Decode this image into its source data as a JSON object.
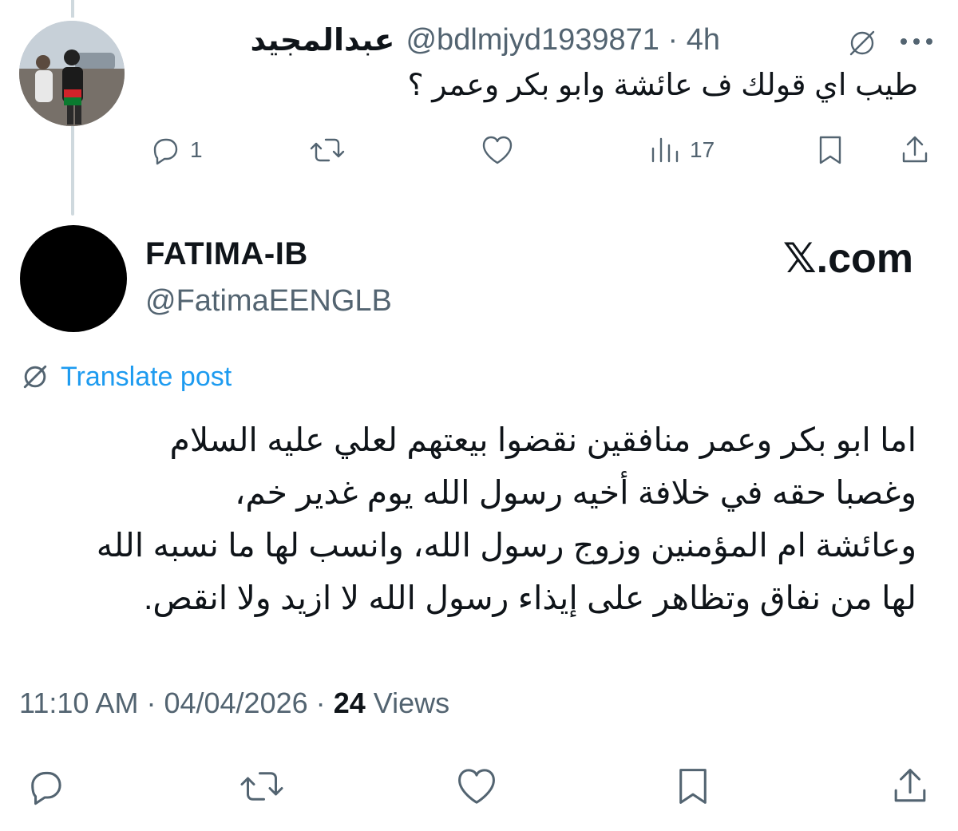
{
  "reply": {
    "display_name": "عبدالمجيد",
    "handle": "@bdlmjyd1939871",
    "separator": "·",
    "time": "4h",
    "text": "طيب اي قولك ف عائشة وابو بكر وعمر ؟",
    "counts": {
      "replies": "1",
      "views": "17"
    }
  },
  "main": {
    "display_name": "FATIMA-IB",
    "handle": "@FatimaEENGLB",
    "brand": "𝕏.com",
    "translate_label": "Translate post",
    "lines": [
      "اما ابو بكر وعمر منافقين نقضوا بيعتهم لعلي عليه السلام",
      "وغصبا حقه في خلافة أخيه رسول الله يوم غدير خم،",
      "وعائشة ام المؤمنين وزوج رسول الله، وانسب لها ما نسبه الله",
      "لها من نفاق وتظاهر على إيذاء رسول الله لا ازيد ولا انقص."
    ],
    "time": "11:10 AM",
    "date": "04/04/2026",
    "views_count": "24",
    "views_label": "Views",
    "dot": "·"
  },
  "icons": [
    "reply-icon",
    "retweet-icon",
    "like-icon",
    "views-icon",
    "bookmark-icon",
    "share-icon",
    "translate-icon",
    "more-icon"
  ],
  "colors": {
    "link": "#1d9bf0",
    "secondary": "#536471",
    "primary": "#0f1419",
    "thread_line": "#cfd9de"
  }
}
